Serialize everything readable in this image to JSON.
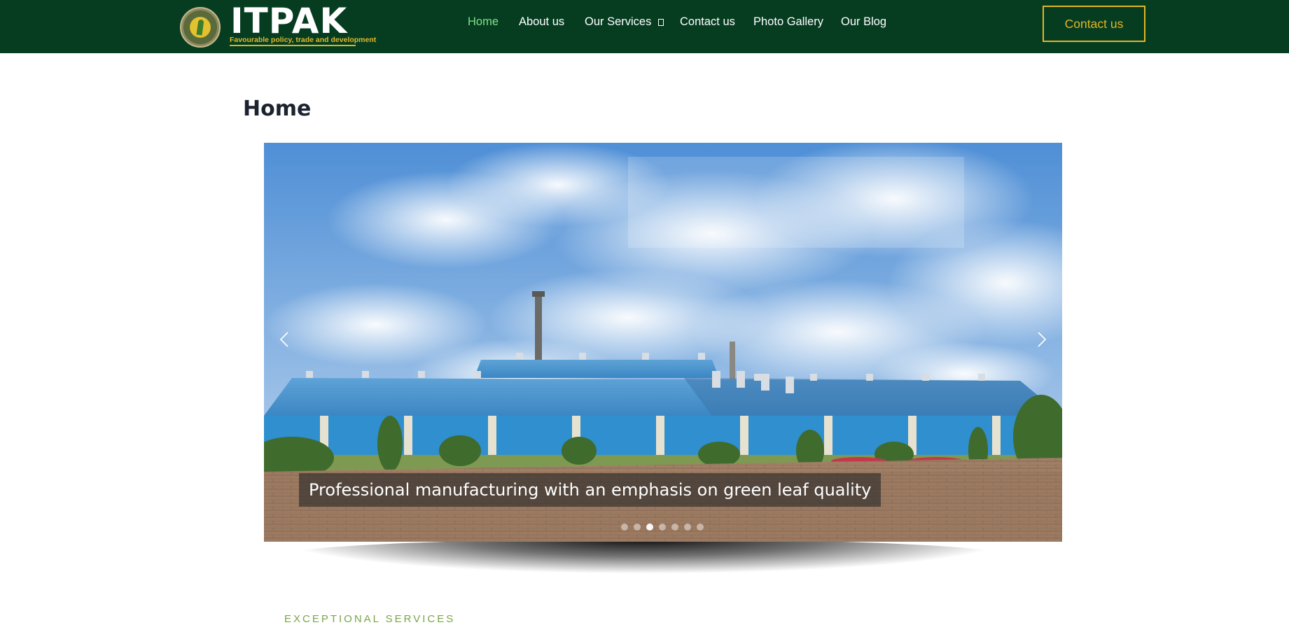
{
  "brand": {
    "name": "ITPAK",
    "tagline": "Favourable policy, trade and development",
    "seal_text": "ITPAK"
  },
  "nav": {
    "items": [
      {
        "label": "Home",
        "active": true
      },
      {
        "label": "About us",
        "active": false
      },
      {
        "label": "Our Services",
        "active": false,
        "has_dropdown": true
      },
      {
        "label": "Contact us",
        "active": false
      },
      {
        "label": "Photo Gallery",
        "active": false
      },
      {
        "label": "Our Blog",
        "active": false
      }
    ],
    "cta_label": "Contact us"
  },
  "page": {
    "title": "Home"
  },
  "slider": {
    "caption": "Professional manufacturing with an emphasis on green leaf quality",
    "slide_count": 7,
    "active_index": 2,
    "prev_icon": "chevron-left-icon",
    "next_icon": "chevron-right-icon"
  },
  "section": {
    "label": "EXCEPTIONAL SERVICES"
  },
  "colors": {
    "header_bg": "#063d21",
    "nav_active": "#7fe08a",
    "accent_gold": "#e3b525",
    "section_label": "#7aa546",
    "title": "#1c2330"
  }
}
